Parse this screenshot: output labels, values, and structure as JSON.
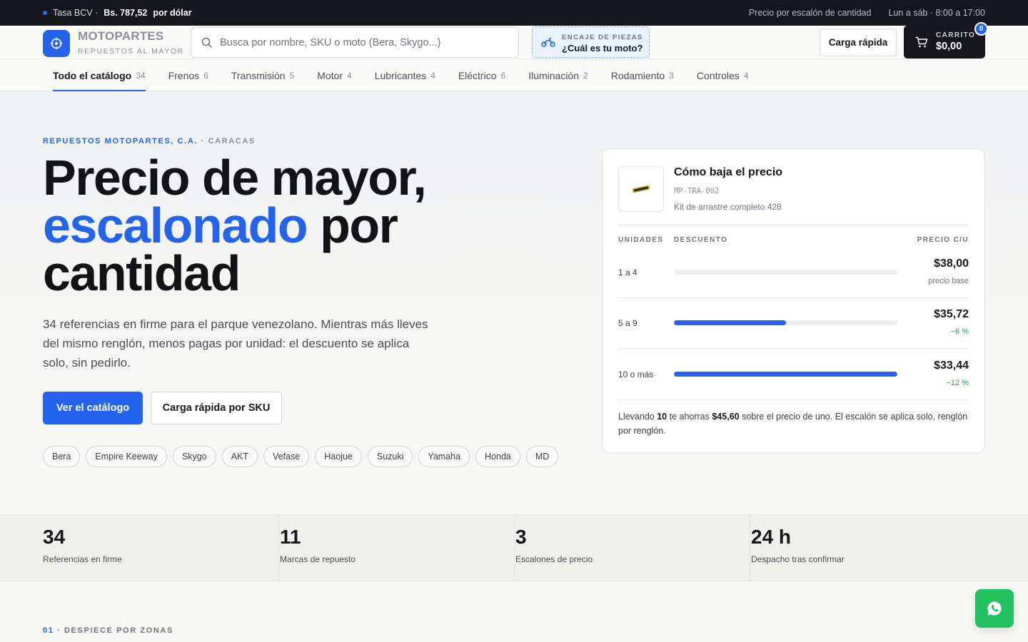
{
  "topbar": {
    "rate_label": "Tasa BCV ·",
    "rate_value": "Bs. 787,52",
    "rate_suffix": "por dólar",
    "tier_note": "Precio por escalón de cantidad",
    "hours": "Lun a sáb · 8:00 a 17:00"
  },
  "header": {
    "logo_title": "MOTOPARTES",
    "logo_subtitle": "REPUESTOS AL MAYOR",
    "search_placeholder": "Busca por nombre, SKU o moto (Bera, Skygo...)",
    "search_value": "",
    "fit_label": "ENCAJE DE PIEZAS",
    "fit_question": "¿Cuál es tu moto?",
    "quick_load": "Carga rápida",
    "cart_label": "CARRITO",
    "cart_total": "$0,00",
    "cart_count": "0"
  },
  "categories": [
    {
      "label": "Todo el catálogo",
      "count": "34",
      "active": true
    },
    {
      "label": "Frenos",
      "count": "6"
    },
    {
      "label": "Transmisión",
      "count": "5"
    },
    {
      "label": "Motor",
      "count": "4"
    },
    {
      "label": "Lubricantes",
      "count": "4"
    },
    {
      "label": "Eléctrico",
      "count": "6"
    },
    {
      "label": "Iluminación",
      "count": "2"
    },
    {
      "label": "Rodamiento",
      "count": "3"
    },
    {
      "label": "Controles",
      "count": "4"
    }
  ],
  "hero": {
    "eyebrow_company": "REPUESTOS MOTOPARTES, C.A.",
    "eyebrow_sep": " · ",
    "eyebrow_city": "CARACAS",
    "title_line1": "Precio de mayor,",
    "title_highlight": "escalonado",
    "title_rest": " por",
    "title_line3": "cantidad",
    "lead": "34 referencias en firme para el parque venezolano. Mientras más lleves del mismo renglón, menos pagas por unidad: el descuento se aplica solo, sin pedirlo.",
    "cta_primary": "Ver el catálogo",
    "cta_secondary": "Carga rápida por SKU",
    "brands": [
      "Bera",
      "Empire Keeway",
      "Skygo",
      "AKT",
      "Vefase",
      "Haojue",
      "Suzuki",
      "Yamaha",
      "Honda",
      "MD"
    ]
  },
  "price_card": {
    "title": "Cómo baja el precio",
    "sku": "MP-TRA-002",
    "product_name": "Kit de arrastre completo 428",
    "col_units": "UNIDADES",
    "col_discount": "DESCUENTO",
    "col_price": "PRECIO C/U",
    "tiers": [
      {
        "units": "1 a 4",
        "discount_fill": 0,
        "price": "$38,00",
        "note": "precio base"
      },
      {
        "units": "5 a 9",
        "discount_fill": 0.5,
        "price": "$35,72",
        "note": "−6 %"
      },
      {
        "units": "10 o más",
        "discount_fill": 1,
        "price": "$33,44",
        "note": "−12 %"
      }
    ],
    "footer_pre": "Llevando ",
    "footer_qty": "10",
    "footer_mid": " te ahorras ",
    "footer_amount": "$45,60",
    "footer_post": " sobre el precio de uno. El escalón se aplica solo, renglón por renglón."
  },
  "stats": [
    {
      "number": "34",
      "label": "Referencias en firme"
    },
    {
      "number": "11",
      "label": "Marcas de repuesto"
    },
    {
      "number": "3",
      "label": "Escalones de precio"
    },
    {
      "number": "24 h",
      "label": "Despacho tras confirmar"
    }
  ],
  "section": {
    "num": "01",
    "sep": " · ",
    "label": "DESPIECE POR ZONAS"
  },
  "colors": {
    "accent": "#2463eb",
    "dark": "#15171c",
    "positive": "#1fa35b",
    "whatsapp": "#22c35e"
  },
  "icons": {
    "logo": "crosshair-icon",
    "search": "search-icon",
    "fit": "motorcycle-icon",
    "cart": "cart-icon",
    "whatsapp": "whatsapp-icon"
  }
}
